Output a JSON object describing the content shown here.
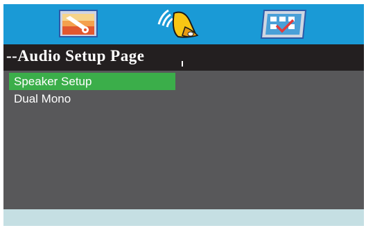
{
  "title": "--Audio Setup Page",
  "tabs": [
    {
      "name": "general-setup",
      "icon": "general-setup-icon"
    },
    {
      "name": "audio-setup",
      "icon": "speaker-icon",
      "active": true
    },
    {
      "name": "preference",
      "icon": "preference-checkmark-icon"
    }
  ],
  "menu": {
    "items": [
      {
        "label": "Speaker  Setup",
        "selected": true
      },
      {
        "label": "Dual  Mono",
        "selected": false
      }
    ]
  },
  "colors": {
    "icon_bar": "#1a9ad6",
    "title_bar": "#231f20",
    "panel": "#58585a",
    "highlight": "#3bae4a",
    "help_bar": "#c5dfe3"
  }
}
